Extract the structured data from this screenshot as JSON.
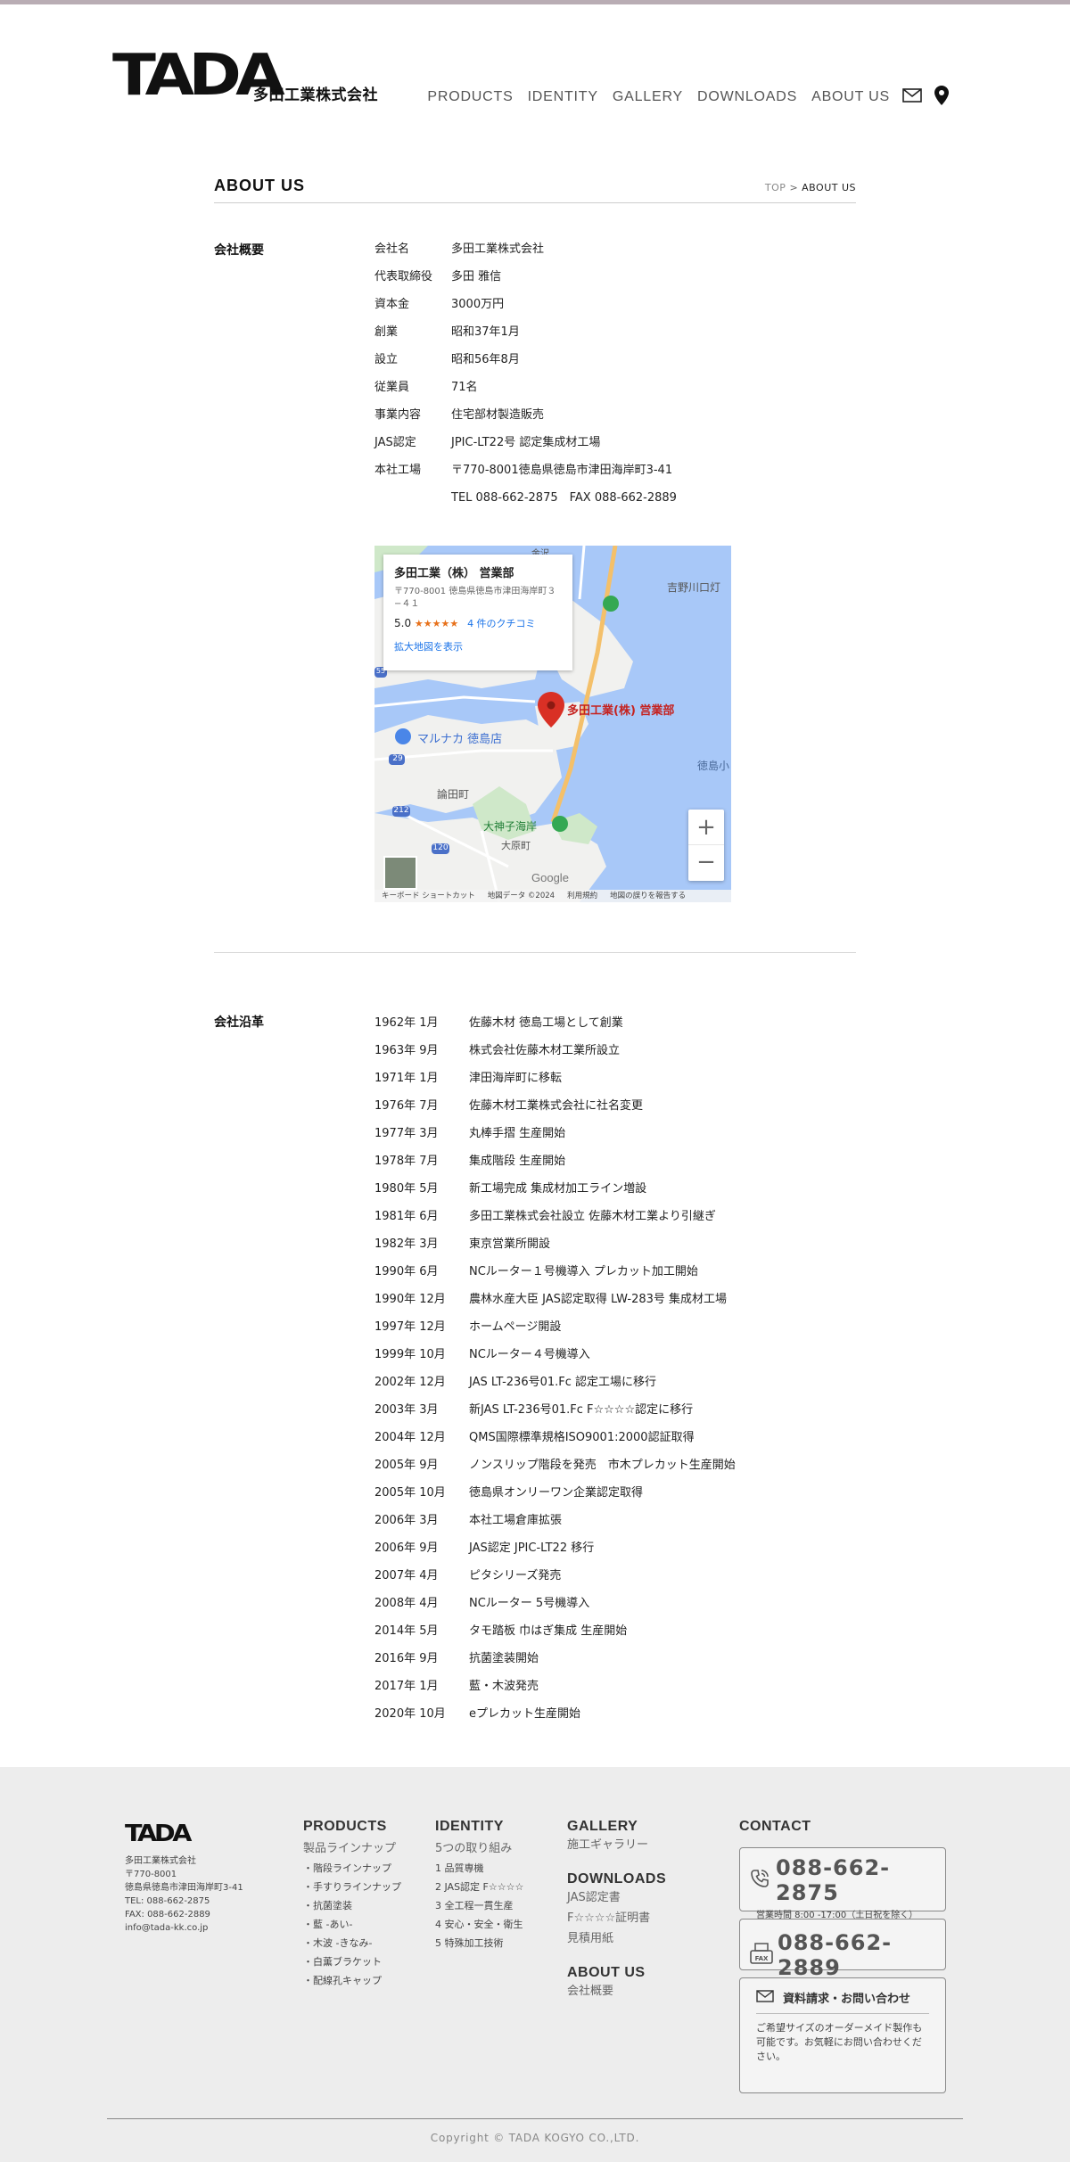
{
  "header": {
    "logo_mark": "TADA",
    "logo_company": "多田工業株式会社",
    "nav": [
      "PRODUCTS",
      "IDENTITY",
      "GALLERY",
      "DOWNLOADS",
      "ABOUT US"
    ]
  },
  "page": {
    "title": "ABOUT US",
    "breadcrumb_home": "TOP",
    "breadcrumb_sep": ">",
    "breadcrumb_current": "ABOUT US"
  },
  "overview": {
    "label": "会社概要",
    "rows": [
      {
        "key": "会社名",
        "value": "多田工業株式会社"
      },
      {
        "key": "代表取締役",
        "value": "多田 雅信"
      },
      {
        "key": "資本金",
        "value": "3000万円"
      },
      {
        "key": "創業",
        "value": "昭和37年1月"
      },
      {
        "key": "設立",
        "value": "昭和56年8月"
      },
      {
        "key": "従業員",
        "value": "71名"
      },
      {
        "key": "事業内容",
        "value": "住宅部材製造販売"
      },
      {
        "key": "JAS認定",
        "value": "JPIC-LT22号 認定集成材工場"
      },
      {
        "key": "本社工場",
        "value": "〒770-8001徳島県徳島市津田海岸町3-41"
      },
      {
        "key": "",
        "value": "TEL 088-662-2875　FAX 088-662-2889"
      }
    ]
  },
  "map": {
    "card_title": "多田工業（株） 営業部",
    "card_address": "〒770-8001 徳島県徳島市津田海岸町３−４１",
    "rating": "5.0",
    "stars": "★★★★★",
    "reviews": "4 件のクチコミ",
    "larger_map": "拡大地図を表示",
    "pin_label": "多田工業(株) 営業部",
    "place_labels": [
      "マルナカ 徳島店",
      "論田町",
      "大神子海岸",
      "大原町",
      "吉野川口灯",
      "徳島小",
      "金沢",
      "29",
      "212",
      "120",
      "55"
    ],
    "zoom_in": "+",
    "zoom_out": "−",
    "google": "Google",
    "footer_items": [
      "キーボード ショートカット",
      "地図データ ©2024",
      "利用規約",
      "地図の誤りを報告する"
    ]
  },
  "history": {
    "label": "会社沿革",
    "rows": [
      {
        "date": "1962年 1月",
        "text": "佐藤木材 徳島工場として創業"
      },
      {
        "date": "1963年 9月",
        "text": "株式会社佐藤木材工業所設立"
      },
      {
        "date": "1971年 1月",
        "text": "津田海岸町に移転"
      },
      {
        "date": "1976年 7月",
        "text": "佐藤木材工業株式会社に社名変更"
      },
      {
        "date": "1977年 3月",
        "text": "丸棒手摺 生産開始"
      },
      {
        "date": "1978年 7月",
        "text": "集成階段 生産開始"
      },
      {
        "date": "1980年 5月",
        "text": "新工場完成 集成材加工ライン増設"
      },
      {
        "date": "1981年 6月",
        "text": "多田工業株式会社設立 佐藤木材工業より引継ぎ"
      },
      {
        "date": "1982年 3月",
        "text": "東京営業所開設"
      },
      {
        "date": "1990年 6月",
        "text": "NCルーター１号機導入 プレカット加工開始"
      },
      {
        "date": "1990年 12月",
        "text": "農林水産大臣 JAS認定取得 LW-283号 集成材工場"
      },
      {
        "date": "1997年 12月",
        "text": "ホームページ開設"
      },
      {
        "date": "1999年 10月",
        "text": "NCルーター４号機導入"
      },
      {
        "date": "2002年 12月",
        "text": "JAS LT-236号01.Fc 認定工場に移行"
      },
      {
        "date": "2003年 3月",
        "text": "新JAS LT-236号01.Fc F☆☆☆☆認定に移行"
      },
      {
        "date": "2004年 12月",
        "text": "QMS国際標準規格ISO9001:2000認証取得"
      },
      {
        "date": "2005年 9月",
        "text": "ノンスリップ階段を発売　市木プレカット生産開始"
      },
      {
        "date": "2005年 10月",
        "text": "徳島県オンリーワン企業認定取得"
      },
      {
        "date": "2006年 3月",
        "text": "本社工場倉庫拡張"
      },
      {
        "date": "2006年 9月",
        "text": "JAS認定 JPIC-LT22 移行"
      },
      {
        "date": "2007年 4月",
        "text": "ピタシリーズ発売"
      },
      {
        "date": "2008年 4月",
        "text": "NCルーター 5号機導入"
      },
      {
        "date": "2014年 5月",
        "text": "タモ踏板 巾はぎ集成 生産開始"
      },
      {
        "date": "2016年 9月",
        "text": "抗菌塗装開始"
      },
      {
        "date": "2017年 1月",
        "text": "藍・木波発売"
      },
      {
        "date": "2020年 10月",
        "text": "eプレカット生産開始"
      }
    ]
  },
  "footer": {
    "logo": "TADA",
    "company_lines": [
      "多田工業株式会社",
      "〒770-8001",
      "徳島県徳島市津田海岸町3-41",
      "TEL: 088-662-2875",
      "FAX: 088-662-2889",
      "info@tada-kk.co.jp"
    ],
    "products": {
      "head": "PRODUCTS",
      "sub": "製品ラインナップ",
      "items": [
        "・階段ラインナップ",
        "・手すりラインナップ",
        "・抗菌塗装",
        "・藍 -あい-",
        "・木波 -きなみ-",
        "・白薫ブラケット",
        "・配線孔キャップ"
      ]
    },
    "identity": {
      "head": "IDENTITY",
      "sub": "5つの取り組み",
      "items": [
        "1 品質専機",
        "2 JAS認定 F☆☆☆☆",
        "3 全工程一貫生産",
        "4 安心・安全・衛生",
        "5 特殊加工技術"
      ]
    },
    "gallery": {
      "head": "GALLERY",
      "links": [
        "施工ギャラリー"
      ]
    },
    "downloads": {
      "head": "DOWNLOADS",
      "links": [
        "JAS認定書",
        "F☆☆☆☆証明書",
        "見積用紙"
      ]
    },
    "aboutus": {
      "head": "ABOUT US",
      "links": [
        "会社概要"
      ]
    },
    "contact": {
      "head": "CONTACT",
      "tel": "088-662-2875",
      "hours": "営業時間 8:00 -17:00（土日祝を除く）",
      "fax": "088-662-2889",
      "inquiry": "資料請求・お問い合わせ",
      "inquiry_note": "ご希望サイズのオーダーメイド製作も可能です。お気軽にお問い合わせください。"
    },
    "copyright": "Copyright © TADA KOGYO CO.,LTD."
  },
  "colors": {
    "accent_red": "#d93025",
    "map_water": "#a8c8f8",
    "map_land": "#f1f1ef",
    "footer_bg": "#ededed"
  }
}
